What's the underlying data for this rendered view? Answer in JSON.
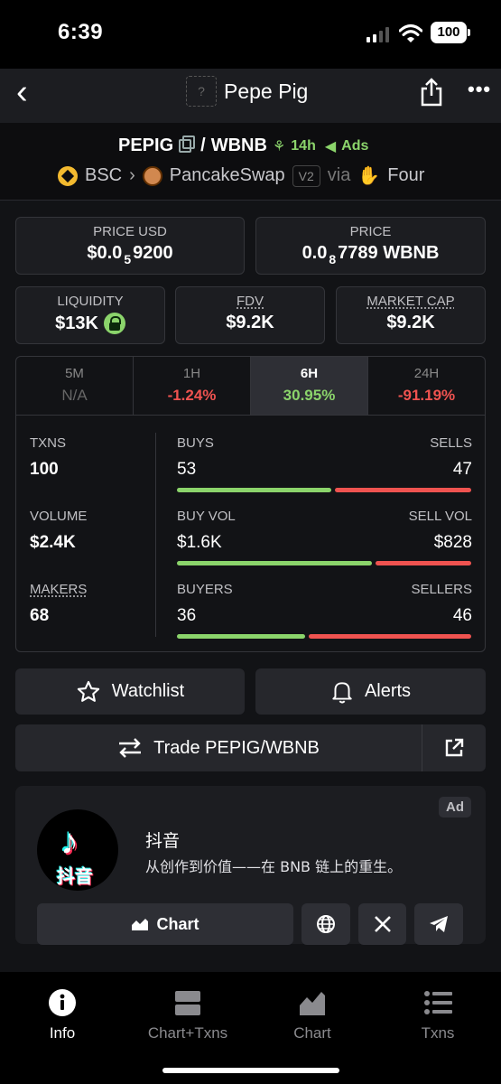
{
  "status": {
    "time": "6:39",
    "battery": "100"
  },
  "nav": {
    "placeholder_icon": "?",
    "title": "Pepe Pig"
  },
  "pair": {
    "base": "PEPIG",
    "sep": "/",
    "quote": "WBNB",
    "age": "14h",
    "ads": "Ads",
    "chain": "BSC",
    "dex": "PancakeSwap",
    "version": "V2",
    "via": "via",
    "launchpad": "Four"
  },
  "cards": {
    "price_usd_label": "PRICE USD",
    "price_usd_a": "$0.0",
    "price_usd_sub": "5",
    "price_usd_b": "9200",
    "price_label": "PRICE",
    "price_a": "0.0",
    "price_sub": "8",
    "price_b": "7789 WBNB",
    "liquidity_label": "LIQUIDITY",
    "liquidity": "$13K",
    "fdv_label": "FDV",
    "fdv": "$9.2K",
    "mcap_label": "MARKET CAP",
    "mcap": "$9.2K"
  },
  "timeframes": [
    {
      "label": "5M",
      "value": "N/A"
    },
    {
      "label": "1H",
      "value": "-1.24%"
    },
    {
      "label": "6H",
      "value": "30.95%"
    },
    {
      "label": "24H",
      "value": "-91.19%"
    }
  ],
  "stats": [
    {
      "left_label": "TXNS",
      "left_value": "100",
      "buy_label": "BUYS",
      "sell_label": "SELLS",
      "buy_value": "53",
      "sell_value": "47",
      "buy_fraction": 0.53
    },
    {
      "left_label": "VOLUME",
      "left_value": "$2.4K",
      "buy_label": "BUY VOL",
      "sell_label": "SELL VOL",
      "buy_value": "$1.6K",
      "sell_value": "$828",
      "buy_fraction": 0.67
    },
    {
      "left_label": "MAKERS",
      "left_value": "68",
      "buy_label": "BUYERS",
      "sell_label": "SELLERS",
      "buy_value": "36",
      "sell_value": "46",
      "buy_fraction": 0.44
    }
  ],
  "actions": {
    "watchlist": "Watchlist",
    "alerts": "Alerts",
    "trade": "Trade PEPIG/WBNB"
  },
  "ad": {
    "tag": "Ad",
    "logo_text": "抖音",
    "name": "抖音",
    "description": "从创作到价值——在 BNB 链上的重生。",
    "chart_button": "Chart"
  },
  "tabbar": [
    {
      "label": "Info"
    },
    {
      "label": "Chart+Txns"
    },
    {
      "label": "Chart"
    },
    {
      "label": "Txns"
    }
  ],
  "colors": {
    "buy": "#8bd46b",
    "sell": "#ef5350",
    "background": "#121316"
  }
}
